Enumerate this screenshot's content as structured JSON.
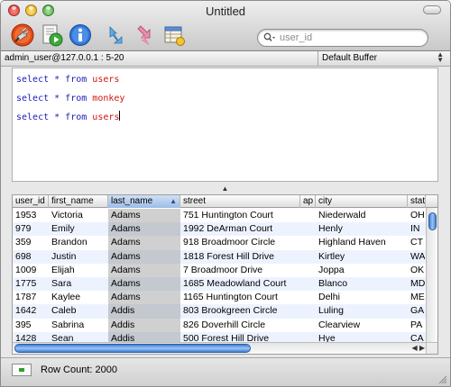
{
  "window": {
    "title": "Untitled"
  },
  "toolbar": {
    "buttons": [
      {
        "name": "disconnect",
        "icon": "plug-icon"
      },
      {
        "name": "run",
        "icon": "run-script-icon"
      },
      {
        "name": "info",
        "icon": "info-icon"
      },
      {
        "name": "import",
        "icon": "import-arrow-icon"
      },
      {
        "name": "export",
        "icon": "export-arrow-icon"
      },
      {
        "name": "history",
        "icon": "table-history-icon"
      }
    ],
    "search": {
      "value": "",
      "placeholder": "user_id"
    }
  },
  "connection": {
    "host": "admin_user@127.0.0.1 : 5-20",
    "buffer": "Default Buffer"
  },
  "editor": {
    "colors": {
      "keyword": "#1a1ab8",
      "table": "#d21414"
    },
    "queries": [
      {
        "keyword": "select * from ",
        "table": "users"
      },
      {
        "keyword": "select * from ",
        "table": "monkey"
      },
      {
        "keyword": "select * from ",
        "table": "users"
      }
    ]
  },
  "results": {
    "columns": [
      "user_id",
      "first_name",
      "last_name",
      "street",
      "ap",
      "city",
      "stat"
    ],
    "sorted_column": "last_name",
    "rows": [
      [
        "1953",
        "Victoria",
        "Adams",
        "751 Huntington Court",
        "",
        "Niederwald",
        "OH"
      ],
      [
        "979",
        "Emily",
        "Adams",
        "1992 DeArman Court",
        "",
        "Henly",
        "IN"
      ],
      [
        "359",
        "Brandon",
        "Adams",
        "918 Broadmoor Circle",
        "",
        "Highland Haven",
        "CT"
      ],
      [
        "698",
        "Justin",
        "Adams",
        "1818 Forest Hill Drive",
        "",
        "Kirtley",
        "WA"
      ],
      [
        "1009",
        "Elijah",
        "Adams",
        "7 Broadmoor Drive",
        "",
        "Joppa",
        "OK"
      ],
      [
        "1775",
        "Sara",
        "Adams",
        "1685 Meadowland Court",
        "",
        "Blanco",
        "MD"
      ],
      [
        "1787",
        "Kaylee",
        "Adams",
        "1165 Huntington Court",
        "",
        "Delhi",
        "ME"
      ],
      [
        "1642",
        "Caleb",
        "Addis",
        "803 Brookgreen Circle",
        "",
        "Luling",
        "GA"
      ],
      [
        "395",
        "Sabrina",
        "Addis",
        "826 Doverhill Circle",
        "",
        "Clearview",
        "PA"
      ],
      [
        "1428",
        "Sean",
        "Addis",
        "500 Forest Hill Drive",
        "",
        "Hye",
        "CA"
      ]
    ]
  },
  "status": {
    "row_count": "Row Count: 2000"
  }
}
